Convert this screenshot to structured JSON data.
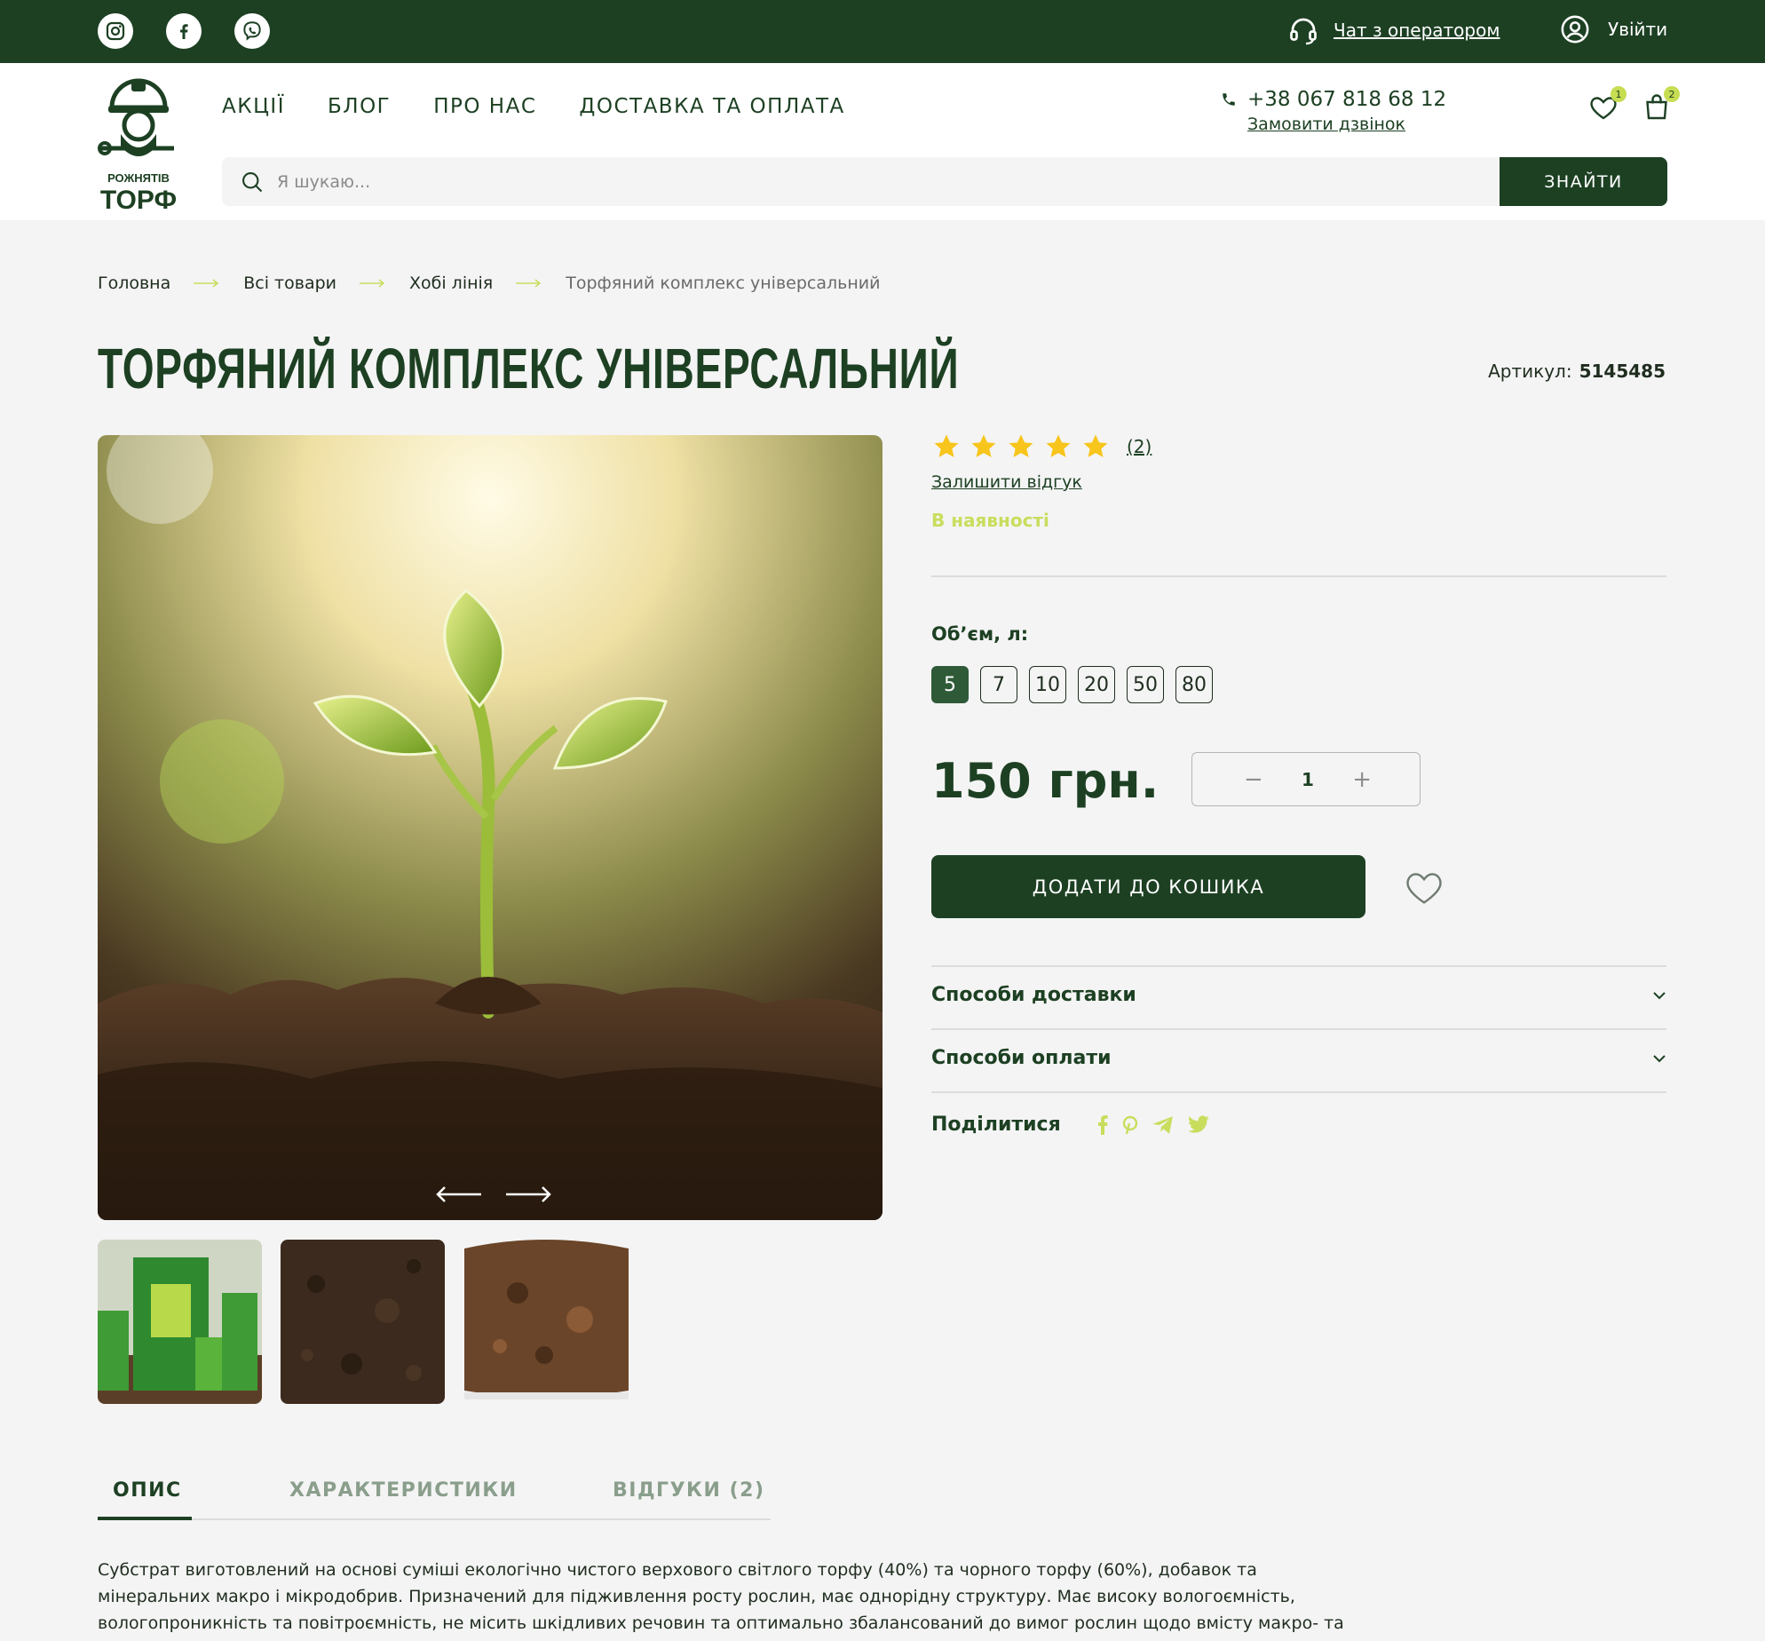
{
  "topbar": {
    "social": [
      "instagram-icon",
      "facebook-icon",
      "viber-icon"
    ],
    "chat_label": "Чат з оператором",
    "login_label": "Увійти"
  },
  "header": {
    "logo_text_top": "РОЖНЯТІВ",
    "logo_text_bottom": "ТОРФ",
    "nav": [
      "АКЦІЇ",
      "БЛОГ",
      "ПРО НАС",
      "ДОСТАВКА ТА ОПЛАТА"
    ],
    "phone": "+38 067 818 68 12",
    "callback_label": "Замовити дзвінок",
    "wishlist_count": "1",
    "cart_count": "2",
    "search_placeholder": "Я шукаю...",
    "search_button": "ЗНАЙТИ"
  },
  "breadcrumb": [
    "Головна",
    "Всі товари",
    "Хобі лінія",
    "Торфяний комплекс універсальний"
  ],
  "product": {
    "title": "ТОРФЯНИЙ КОМПЛЕКС УНІВЕРСАЛЬНИЙ",
    "sku_label": "Артикул:",
    "sku": "5145485",
    "rating": 5,
    "reviews_count": "(2)",
    "leave_review": "Залишити відгук",
    "stock": "В наявності",
    "volume_label": "Об’єм, л:",
    "volumes": [
      "5",
      "7",
      "10",
      "20",
      "50",
      "80"
    ],
    "selected_volume": "5",
    "price": "150 грн.",
    "quantity": "1",
    "add_to_cart": "ДОДАТИ ДО КОШИКА",
    "delivery_label": "Способи доставки",
    "payment_label": "Способи оплати",
    "share_label": "Поділитися"
  },
  "tabs": [
    "ОПИС",
    "ХАРАКТЕРИСТИКИ",
    "ВІДГУКИ (2)"
  ],
  "description": "Субстрат виготовлений на основі суміші екологічно чистого верхового світлого торфу (40%) та чорного торфу (60%), добавок та мінеральних макро і мікродобрив. Призначений для підживлення росту рослин, має однорідну структуру. Має високу вологоємність, вологопроникність та повітроємність, не місить шкідливих речовин та оптимально збалансований до вимог рослин щодо вмісту макро- та",
  "colors": {
    "brand": "#1d4023",
    "accent": "#c7dd52",
    "star": "#f7c51b"
  }
}
